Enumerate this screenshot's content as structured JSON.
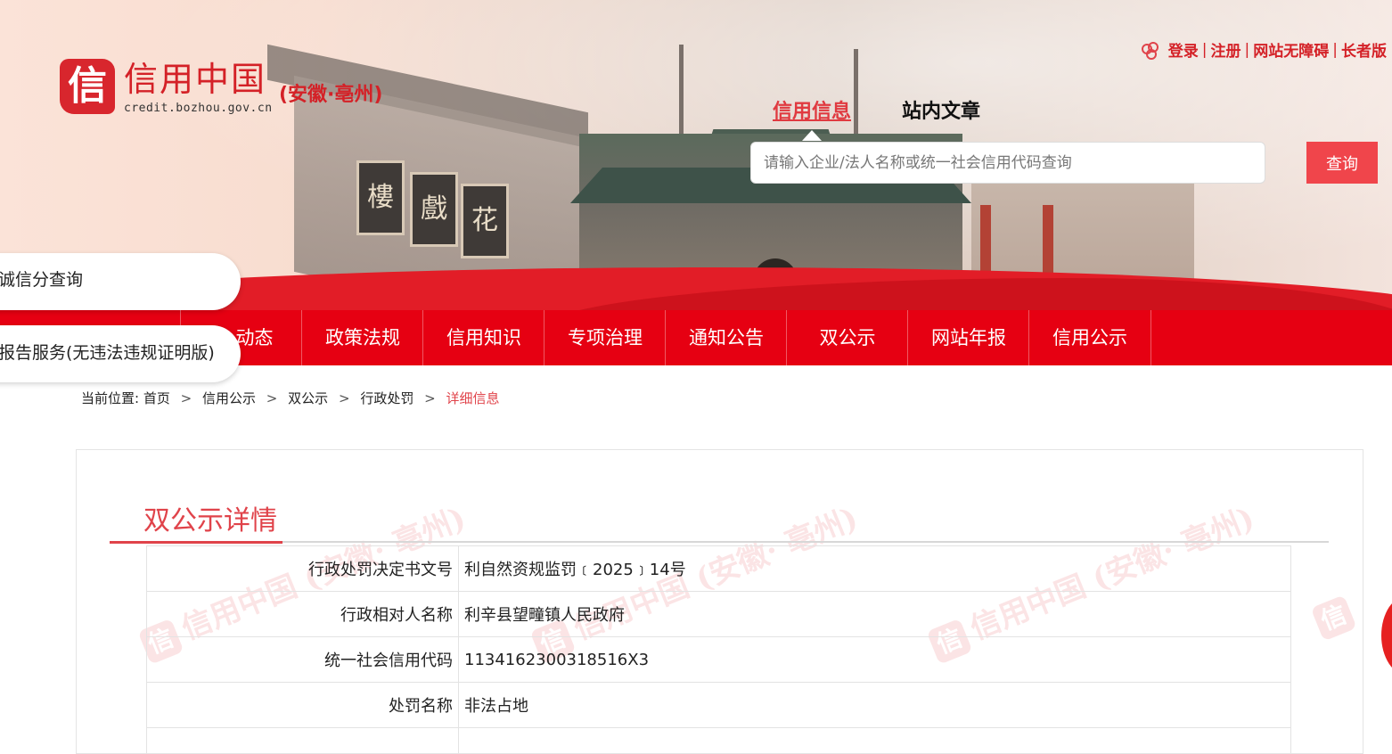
{
  "header": {
    "logo_seal": "信",
    "logo_title": "信用中国",
    "logo_url": "credit.bozhou.gov.cn",
    "logo_region": "(安徽·亳州)",
    "top_links": [
      "登录",
      "注册",
      "网站无障碍",
      "长者版"
    ],
    "plaques": [
      "樓",
      "戲",
      "花"
    ]
  },
  "search": {
    "tabs": [
      "信用信息",
      "站内文章"
    ],
    "placeholder": "请输入企业/法人名称或统一社会信用代码查询",
    "button_label": "查询"
  },
  "nav": {
    "items": [
      "动态",
      "政策法规",
      "信用知识",
      "专项治理",
      "通知公告",
      "双公示",
      "网站年报",
      "信用公示"
    ]
  },
  "floating": {
    "pill1": "诚信分查询",
    "pill2": "报告服务(无违法违规证明版)"
  },
  "breadcrumb": {
    "prefix": "当前位置:",
    "items": [
      "首页",
      "信用公示",
      "双公示",
      "行政处罚"
    ],
    "current": "详细信息"
  },
  "detail": {
    "title": "双公示详情",
    "watermark": "信用中国 (安徽· 亳州)",
    "rows": [
      {
        "key": "行政处罚决定书文号",
        "value": "利自然资规监罚﹝2025﹞14号"
      },
      {
        "key": "行政相对人名称",
        "value": "利辛县望疃镇人民政府"
      },
      {
        "key": "统一社会信用代码",
        "value": "1134162300318516X3"
      },
      {
        "key": "处罚名称",
        "value": "非法占地"
      },
      {
        "key": "",
        "value": ""
      }
    ]
  },
  "colors": {
    "brand_red": "#e60012",
    "accent_red": "#e0434a"
  }
}
